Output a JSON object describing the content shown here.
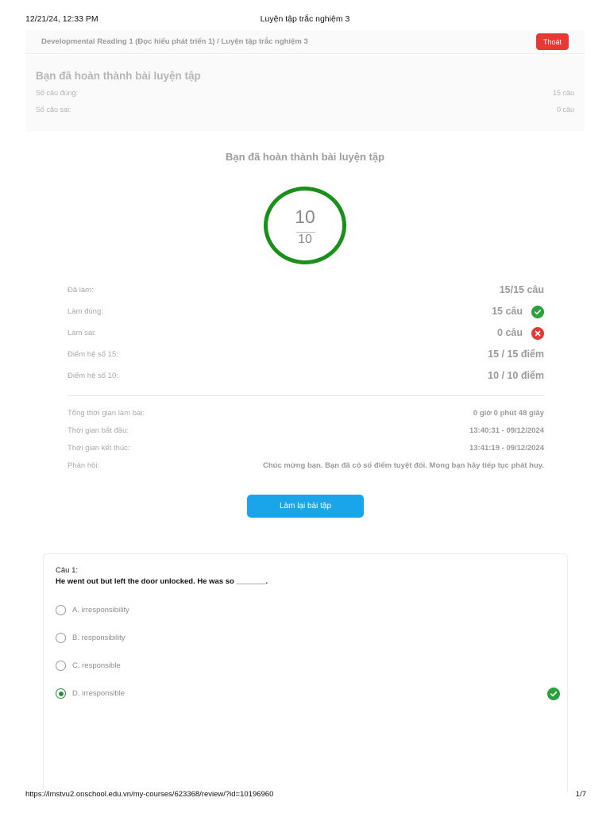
{
  "print": {
    "datetime": "12/21/24, 12:33 PM",
    "doc_title": "Luyện tập trắc nghiệm 3",
    "url": "https://lmstvu2.onschool.edu.vn/my-courses/623368/review/?id=10196960",
    "page": "1/7"
  },
  "header": {
    "breadcrumb": "Developmental Reading 1 (Đọc hiểu phát triển 1) / Luyện tập trắc nghiệm 3",
    "exit_label": "Thoát",
    "exit_color": "#e53935"
  },
  "summary": {
    "title": "Bạn đã hoàn thành bài luyện tập",
    "correct_label": "Số câu đúng:",
    "correct_value": "15 câu",
    "wrong_label": "Số câu sai:",
    "wrong_value": "0 câu"
  },
  "result": {
    "title": "Bạn đã hoàn thành bài luyện tập",
    "score": "10",
    "score_max": "10",
    "ring_color": "#1a8f1a"
  },
  "stats": [
    {
      "label": "Đã làm:",
      "value": "15/15 câu",
      "icon": ""
    },
    {
      "label": "Làm đúng:",
      "value": "15 câu",
      "icon": "check-circle-icon"
    },
    {
      "label": "Làm sai:",
      "value": "0 câu",
      "icon": "x-circle-icon"
    },
    {
      "label": "Điểm hệ số 15:",
      "value": "15 / 15 điểm",
      "icon": ""
    },
    {
      "label": "Điểm hệ số 10:",
      "value": "10 / 10 điểm",
      "icon": ""
    }
  ],
  "times": [
    {
      "label": "Tổng thời gian làm bài:",
      "value": "0 giờ 0 phút 48 giây"
    },
    {
      "label": "Thời gian bắt đầu:",
      "value": "13:40:31 - 09/12/2024"
    },
    {
      "label": "Thời gian kết thúc:",
      "value": "13:41:19 - 09/12/2024"
    },
    {
      "label": "Phản hồi:",
      "value": "Chúc mừng bạn. Bạn đã có số điểm tuyệt đối. Mong bạn hãy tiếp tục phát huy."
    }
  ],
  "retry": {
    "label": "Làm lại bài tập",
    "color": "#1aa4ea"
  },
  "question": {
    "number": "Câu 1:",
    "text": "He went out but left the door unlocked. He was so _______.",
    "options": [
      {
        "label": "A. irresponsibility",
        "selected": false
      },
      {
        "label": "B. responsibility",
        "selected": false
      },
      {
        "label": "C. responsible",
        "selected": false
      },
      {
        "label": "D. irresponsible",
        "selected": true,
        "correct": true
      }
    ]
  }
}
